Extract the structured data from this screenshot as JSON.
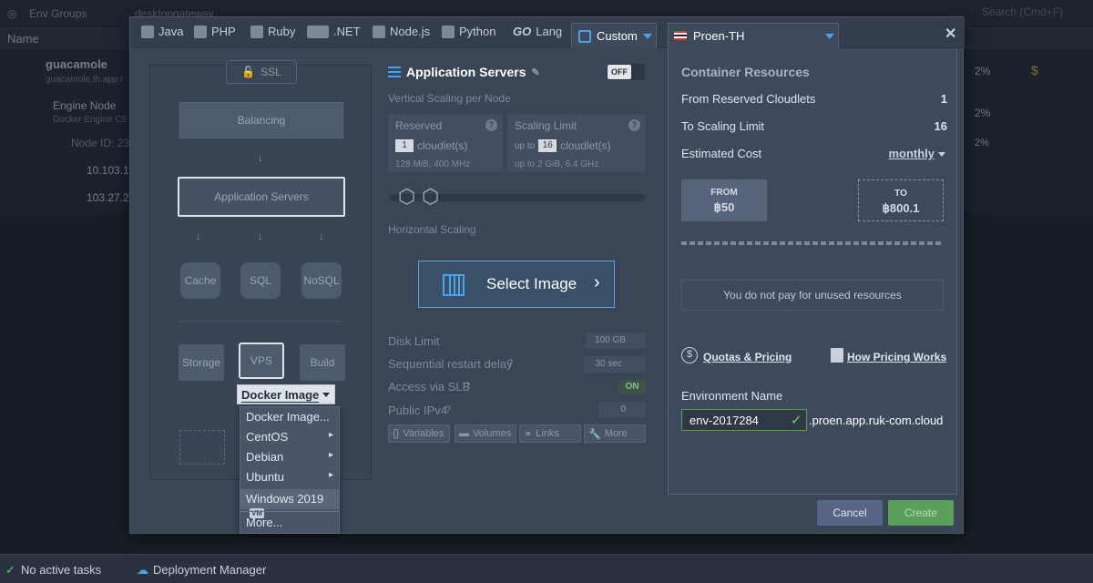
{
  "background": {
    "env_groups": "Env Groups",
    "gateway_tab": "desktopgateway",
    "search_placeholder": "Search (Cmd+F)",
    "name_col": "Name",
    "rows": [
      {
        "title": "guacamole",
        "sub": "guacamole.th.app.r",
        "pct": "2%"
      },
      {
        "title": "Engine Node",
        "sub": "Docker Engine CE 20",
        "pct": "2%"
      },
      {
        "title": "Node ID: 23",
        "pct": "2%"
      },
      {
        "title": "10.103.1"
      },
      {
        "title": "103.27.2"
      }
    ]
  },
  "bottom_bar": {
    "tasks": "No active tasks",
    "deploy": "Deployment Manager"
  },
  "tabs": [
    "Java",
    "PHP",
    "Ruby",
    ".NET",
    "Node.js",
    "Python",
    "Lang",
    "Custom"
  ],
  "tab_go_prefix": "GO",
  "region": "Proen-TH",
  "topology": {
    "ssl": "SSL",
    "balancing": "Balancing",
    "app_servers": "Application Servers",
    "cache": "Cache",
    "sql": "SQL",
    "nosql": "NoSQL",
    "storage": "Storage",
    "vps": "VPS",
    "build": "Build"
  },
  "docker_dropdown": {
    "selected": "Docker Image",
    "items": [
      {
        "label": "Docker Image...",
        "submenu": false
      },
      {
        "label": "CentOS",
        "submenu": true
      },
      {
        "label": "Debian",
        "submenu": true
      },
      {
        "label": "Ubuntu",
        "submenu": true
      },
      {
        "label": "Windows 2019",
        "badge": "VM",
        "submenu": false
      },
      {
        "label": "More...",
        "submenu": false
      }
    ]
  },
  "config": {
    "title": "Application Servers",
    "toggle": "OFF",
    "vertical_label": "Vertical Scaling per Node",
    "reserved": {
      "title": "Reserved",
      "value": "1",
      "unit": "cloudlet(s)",
      "sub": "128 MiB, 400 MHz"
    },
    "scaling": {
      "title": "Scaling Limit",
      "prefix": "up to",
      "value": "16",
      "unit": "cloudlet(s)",
      "sub": "up to 2 GiB, 6.4 GHz"
    },
    "horizontal_label": "Horizontal Scaling",
    "select_image": "Select Image",
    "disk_limit": {
      "label": "Disk Limit",
      "value": "100 GB"
    },
    "restart_delay": {
      "label": "Sequential restart delay",
      "value": "30",
      "unit": "sec"
    },
    "slb": {
      "label": "Access via SLB",
      "value": "ON"
    },
    "ipv4": {
      "label": "Public IPv4",
      "value": "0"
    },
    "buttons": [
      "Variables",
      "Volumes",
      "Links",
      "More"
    ]
  },
  "resources": {
    "title": "Container Resources",
    "from_reserved": {
      "label": "From Reserved Cloudlets",
      "value": "1"
    },
    "to_scaling": {
      "label": "To Scaling Limit",
      "value": "16"
    },
    "estimated": {
      "label": "Estimated Cost",
      "period": "monthly"
    },
    "price_from": {
      "label": "FROM",
      "value": "฿50"
    },
    "price_to": {
      "label": "TO",
      "value": "฿800.1"
    },
    "unused_note": "You do not pay for unused resources",
    "quotas_link": "Quotas & Pricing",
    "pricing_link": "How Pricing Works",
    "env_name_label": "Environment Name",
    "env_name_value": "env-2017284",
    "env_domain": ".proen.app.ruk-com.cloud"
  },
  "footer": {
    "cancel": "Cancel",
    "create": "Create"
  }
}
